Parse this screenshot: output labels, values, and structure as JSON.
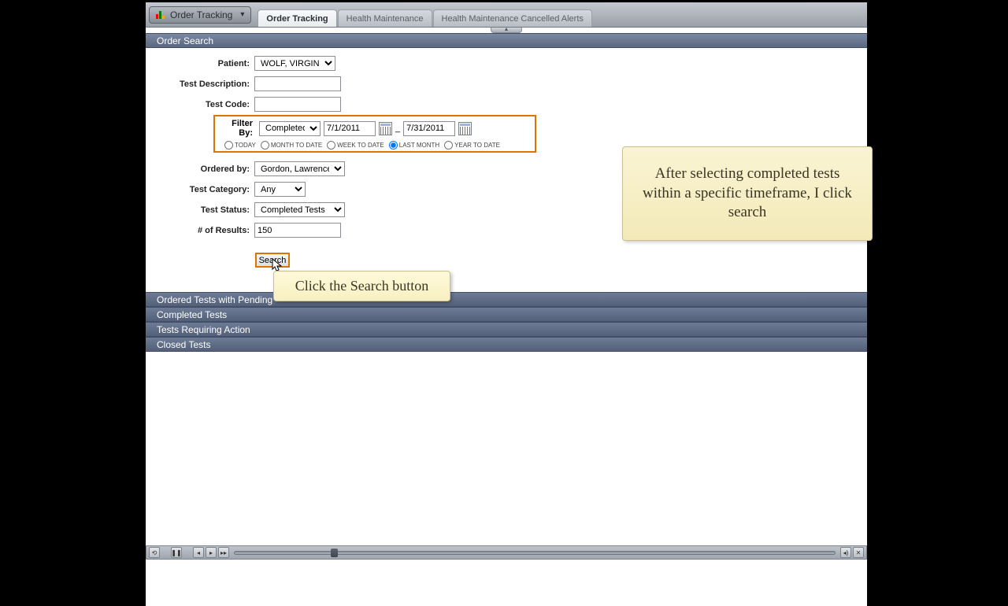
{
  "nav": {
    "dropdown_label": "Order Tracking",
    "tabs": [
      "Order Tracking",
      "Health Maintenance",
      "Health Maintenance Cancelled Alerts"
    ]
  },
  "search": {
    "header": "Order Search",
    "labels": {
      "patient": "Patient:",
      "test_description": "Test Description:",
      "test_code": "Test Code:",
      "filter_by": "Filter By:",
      "ordered_by": "Ordered by:",
      "test_category": "Test Category:",
      "test_status": "Test Status:",
      "num_results": "# of Results:"
    },
    "values": {
      "patient": "WOLF, VIRGINIA",
      "test_description": "",
      "test_code": "",
      "filter_mode": "Completed On",
      "date_from": "7/1/2011",
      "date_sep": "_",
      "date_to": "7/31/2011",
      "ordered_by": "Gordon, Lawrence",
      "test_category": "Any",
      "test_status": "Completed Tests",
      "num_results": "150"
    },
    "radio_options": [
      "TODAY",
      "MONTH TO DATE",
      "WEEK TO DATE",
      "LAST MONTH",
      "YEAR TO DATE"
    ],
    "radio_selected": 3,
    "search_button": "Search"
  },
  "result_sections": [
    "Ordered Tests with Pending",
    "Completed Tests",
    "Tests Requiring Action",
    "Closed Tests"
  ],
  "tooltip": "Click the Search button",
  "note": "After selecting completed tests within a specific timeframe, I click search"
}
